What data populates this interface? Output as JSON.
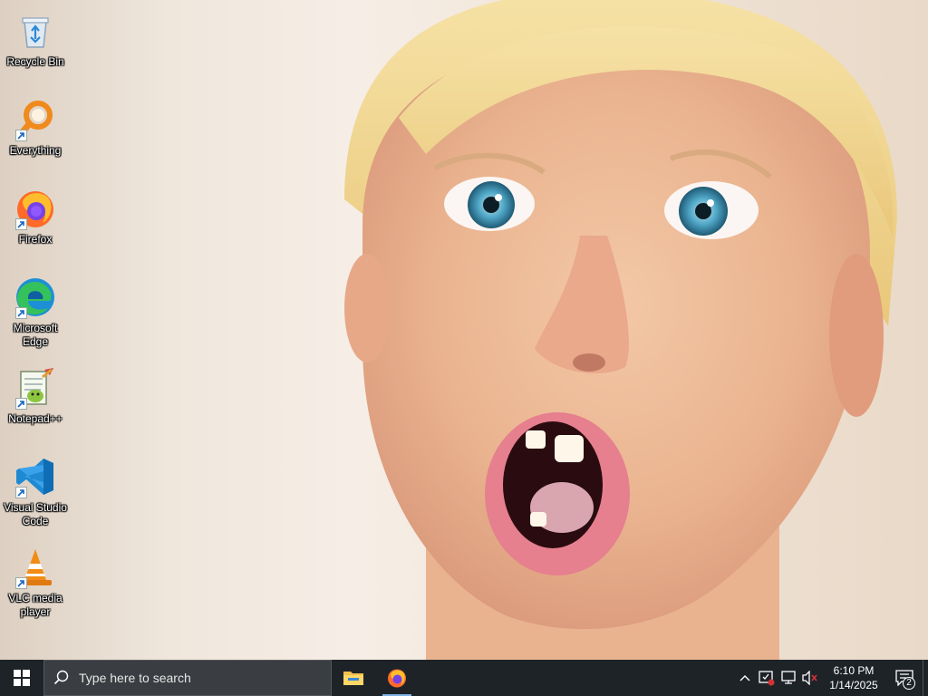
{
  "desktop": {
    "icons": [
      {
        "label": "Recycle Bin",
        "icon": "recycle-bin-icon"
      },
      {
        "label": "Everything",
        "icon": "everything-search-icon"
      },
      {
        "label": "Firefox",
        "icon": "firefox-icon"
      },
      {
        "label": "Microsoft Edge",
        "icon": "edge-icon"
      },
      {
        "label": "Notepad++",
        "icon": "notepad-plus-plus-icon"
      },
      {
        "label": "Visual Studio Code",
        "icon": "vscode-icon"
      },
      {
        "label": "VLC media player",
        "icon": "vlc-icon"
      }
    ]
  },
  "taskbar": {
    "search_placeholder": "Type here to search",
    "pinned": [
      {
        "name": "File Explorer",
        "icon": "file-explorer-icon"
      },
      {
        "name": "Firefox",
        "icon": "firefox-icon",
        "running": true
      }
    ],
    "tray": {
      "icons": [
        "chevron-up-icon",
        "security-icon",
        "network-icon",
        "volume-muted-icon"
      ],
      "time": "6:10 PM",
      "date": "1/14/2025",
      "notification_count": "2"
    }
  },
  "colors": {
    "taskbar_bg": "#1e2328",
    "search_bg": "#3a3d41",
    "accent": "#0078d4"
  }
}
